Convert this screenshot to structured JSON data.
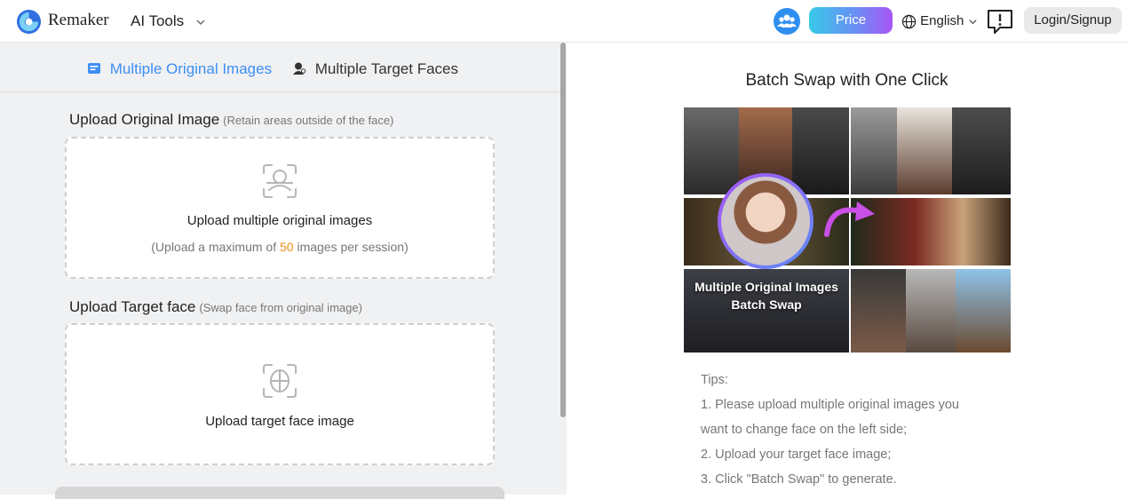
{
  "header": {
    "brand": "Remaker",
    "ai_tools": "AI Tools",
    "price": "Price",
    "language": "English",
    "login": "Login/Signup"
  },
  "tabs": [
    {
      "label": "Multiple Original Images",
      "active": true
    },
    {
      "label": "Multiple Target Faces",
      "active": false
    }
  ],
  "upload_original": {
    "title": "Upload Original Image",
    "hint": "(Retain areas outside of the face)",
    "label": "Upload multiple original images",
    "note_before": "(Upload a maximum of ",
    "note_number": "50",
    "note_after": " images per session)"
  },
  "upload_target": {
    "title": "Upload Target face",
    "hint": "(Swap face from original image)",
    "label": "Upload target face image"
  },
  "demo": {
    "title": "Batch Swap with One Click",
    "caption_line1": "Multiple Original Images",
    "caption_line2": "Batch Swap"
  },
  "tips": {
    "heading": "Tips:",
    "items": [
      "1. Please upload multiple original images you",
      "want to change face on the left side;",
      "2. Upload your target face image;",
      "3. Click \"Batch Swap\" to generate."
    ]
  },
  "colors": {
    "accent": "#3d8ff3",
    "highlight_number": "#f08c1f",
    "price_gradient_start": "#38c9e8",
    "price_gradient_end": "#a855f7"
  },
  "icons": {
    "logo": "remaker-logo-icon",
    "community": "community-icon",
    "globe": "globe-icon",
    "feedback": "feedback-icon",
    "upload_face_scan": "face-scan-icon",
    "upload_target": "target-face-icon"
  }
}
